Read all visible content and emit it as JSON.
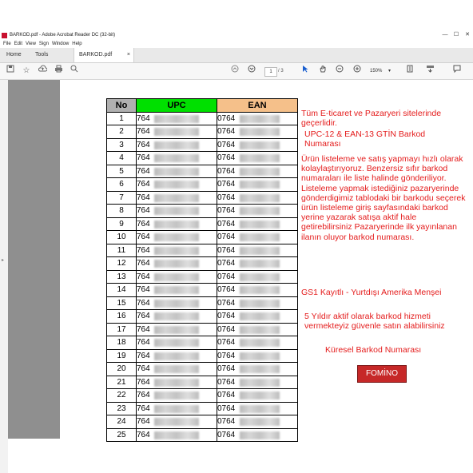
{
  "window": {
    "title": "BARKOD.pdf - Adobe Acrobat Reader DC (32-bit)",
    "controls": [
      "—",
      "☐",
      "✕"
    ]
  },
  "menu": [
    "File",
    "Edit",
    "View",
    "Sign",
    "Window",
    "Help"
  ],
  "tabs": {
    "home": "Home",
    "tools": "Tools",
    "document": "BARKOD.pdf",
    "close": "×"
  },
  "toolbar": {
    "page_current": "1",
    "page_total": "/ 3",
    "zoom": "150%"
  },
  "table": {
    "headers": {
      "no": "No",
      "upc": "UPC",
      "ean": "EAN"
    },
    "upc_prefix": "764",
    "ean_prefix": "0764",
    "row_numbers": [
      "1",
      "2",
      "3",
      "4",
      "5",
      "6",
      "7",
      "8",
      "9",
      "10",
      "11",
      "12",
      "13",
      "14",
      "15",
      "16",
      "17",
      "18",
      "19",
      "20",
      "21",
      "22",
      "23",
      "24",
      "25"
    ]
  },
  "side_text": {
    "p1": "Tüm E-ticaret ve Pazaryeri sitelerinde geçerlidir.",
    "p2": "UPC-12 & EAN-13 GTİN Barkod Numarası",
    "p3": "Ürün listeleme ve satış yapmayı hızlı olarak kolaylaştırıyoruz. Benzersiz sıfır barkod numaraları ile liste halinde gönderiliyor. Listeleme yapmak istediğiniz pazaryerinde gönderdigimiz tablodaki bir barkodu seçerek ürün listeleme giriş sayfasındaki barkod yerine yazarak satışa aktif hale getirebilirsiniz Pazaryerinde ilk yayınlanan ilanın oluyor barkod numarası.",
    "p4": "GS1 Kayıtlı - Yurtdışı Amerika Menşei",
    "p5": "5 Yıldır aktif olarak barkod hizmeti vermekteyiz güvenle satın alabilirsiniz",
    "p6": "Küresel Barkod Numarası"
  },
  "button": {
    "label": "FOMİNO"
  },
  "colors": {
    "upc_header": "#00e000",
    "ean_header": "#f5c08a",
    "text_red": "#e41b1b",
    "button_red": "#c62828"
  }
}
